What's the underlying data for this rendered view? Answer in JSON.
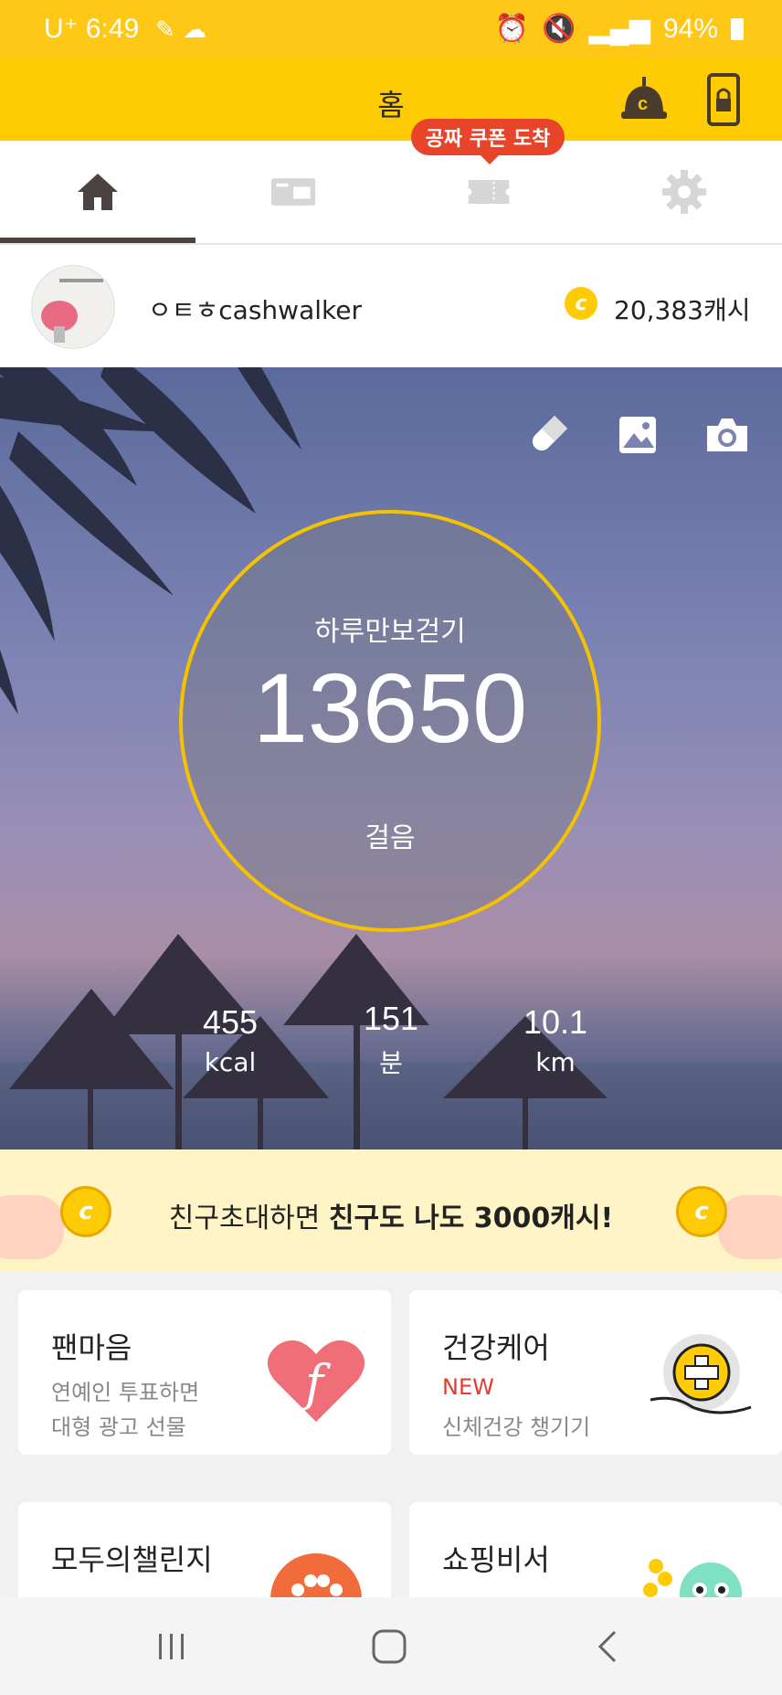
{
  "status_bar": {
    "carrier_time": "U⁺ 6:49",
    "battery": "94%"
  },
  "app_bar": {
    "title": "홈"
  },
  "tabs": {
    "coupon_badge": "공짜 쿠폰 도착"
  },
  "profile": {
    "username": "ㅇㅌㅎcashwalker",
    "cash": "20,383캐시"
  },
  "hero": {
    "circle_title": "하루만보걷기",
    "steps": "13650",
    "steps_unit": "걸음",
    "stats": [
      {
        "value": "455",
        "unit": "kcal"
      },
      {
        "value": "151",
        "unit": "분"
      },
      {
        "value": "10.1",
        "unit": "km"
      }
    ]
  },
  "banner": {
    "text_plain": "친구초대하면 ",
    "text_bold": "친구도 나도 3000캐시!"
  },
  "cards": [
    {
      "title": "팬마음",
      "line1": "연예인 투표하면",
      "line2": "대형 광고 선물"
    },
    {
      "title": "건강케어",
      "line1": "NEW",
      "line2": "신체건강 챙기기"
    },
    {
      "title": "모두의챌린지"
    },
    {
      "title": "쇼핑비서"
    }
  ],
  "colors": {
    "brand_yellow": "#ffcb05",
    "badge_red": "#e8442a",
    "new_red": "#e53b2e"
  }
}
